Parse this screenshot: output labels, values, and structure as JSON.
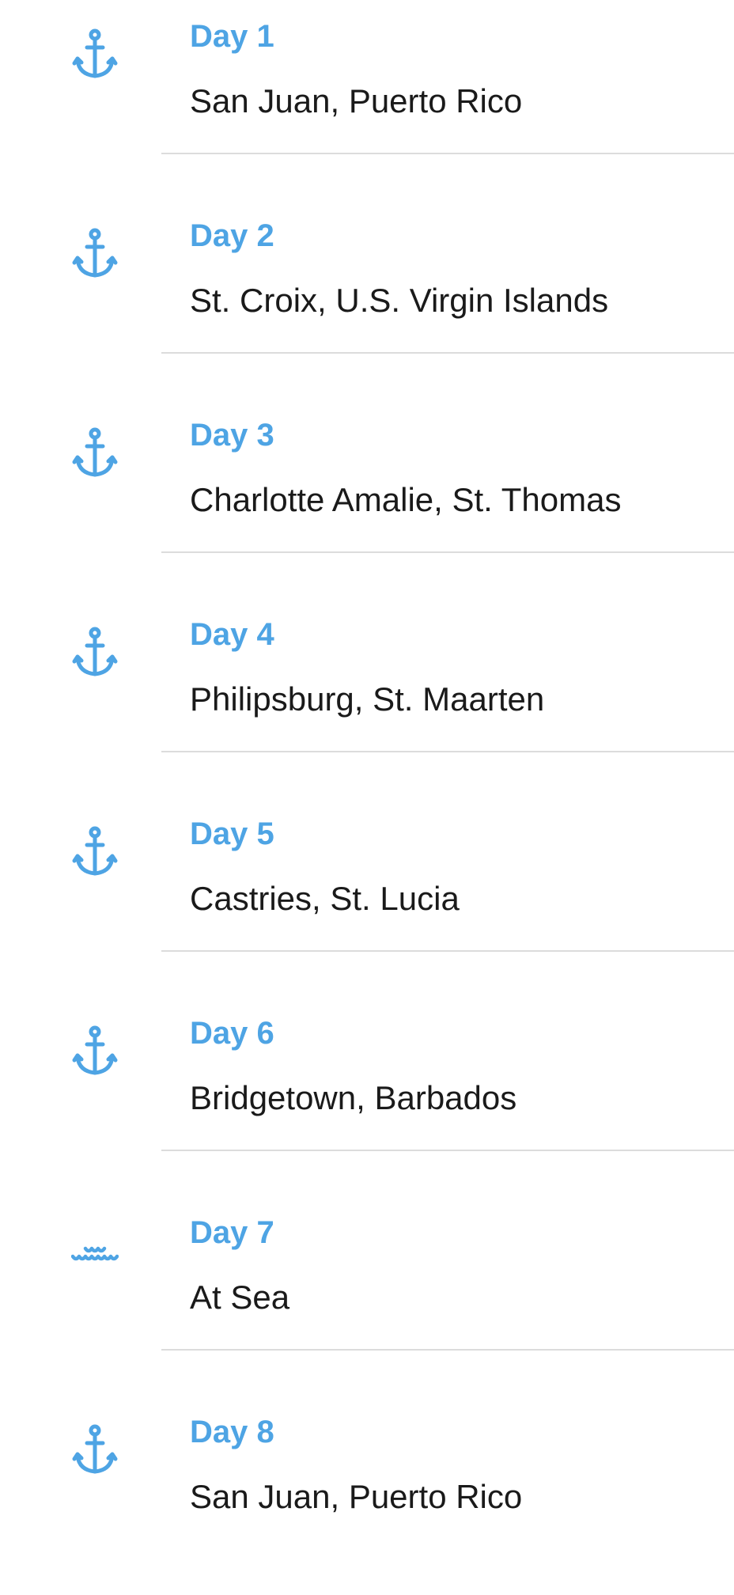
{
  "accent_color": "#4ea4e4",
  "itinerary": [
    {
      "day": "Day 1",
      "port": "San Juan, Puerto Rico",
      "icon": "anchor-icon"
    },
    {
      "day": "Day 2",
      "port": "St. Croix, U.S. Virgin Islands",
      "icon": "anchor-icon"
    },
    {
      "day": "Day 3",
      "port": "Charlotte Amalie, St. Thomas",
      "icon": "anchor-icon"
    },
    {
      "day": "Day 4",
      "port": "Philipsburg, St. Maarten",
      "icon": "anchor-icon"
    },
    {
      "day": "Day 5",
      "port": "Castries, St. Lucia",
      "icon": "anchor-icon"
    },
    {
      "day": "Day 6",
      "port": "Bridgetown, Barbados",
      "icon": "anchor-icon"
    },
    {
      "day": "Day 7",
      "port": "At Sea",
      "icon": "waves-icon"
    },
    {
      "day": "Day 8",
      "port": "San Juan, Puerto Rico",
      "icon": "anchor-icon"
    }
  ]
}
